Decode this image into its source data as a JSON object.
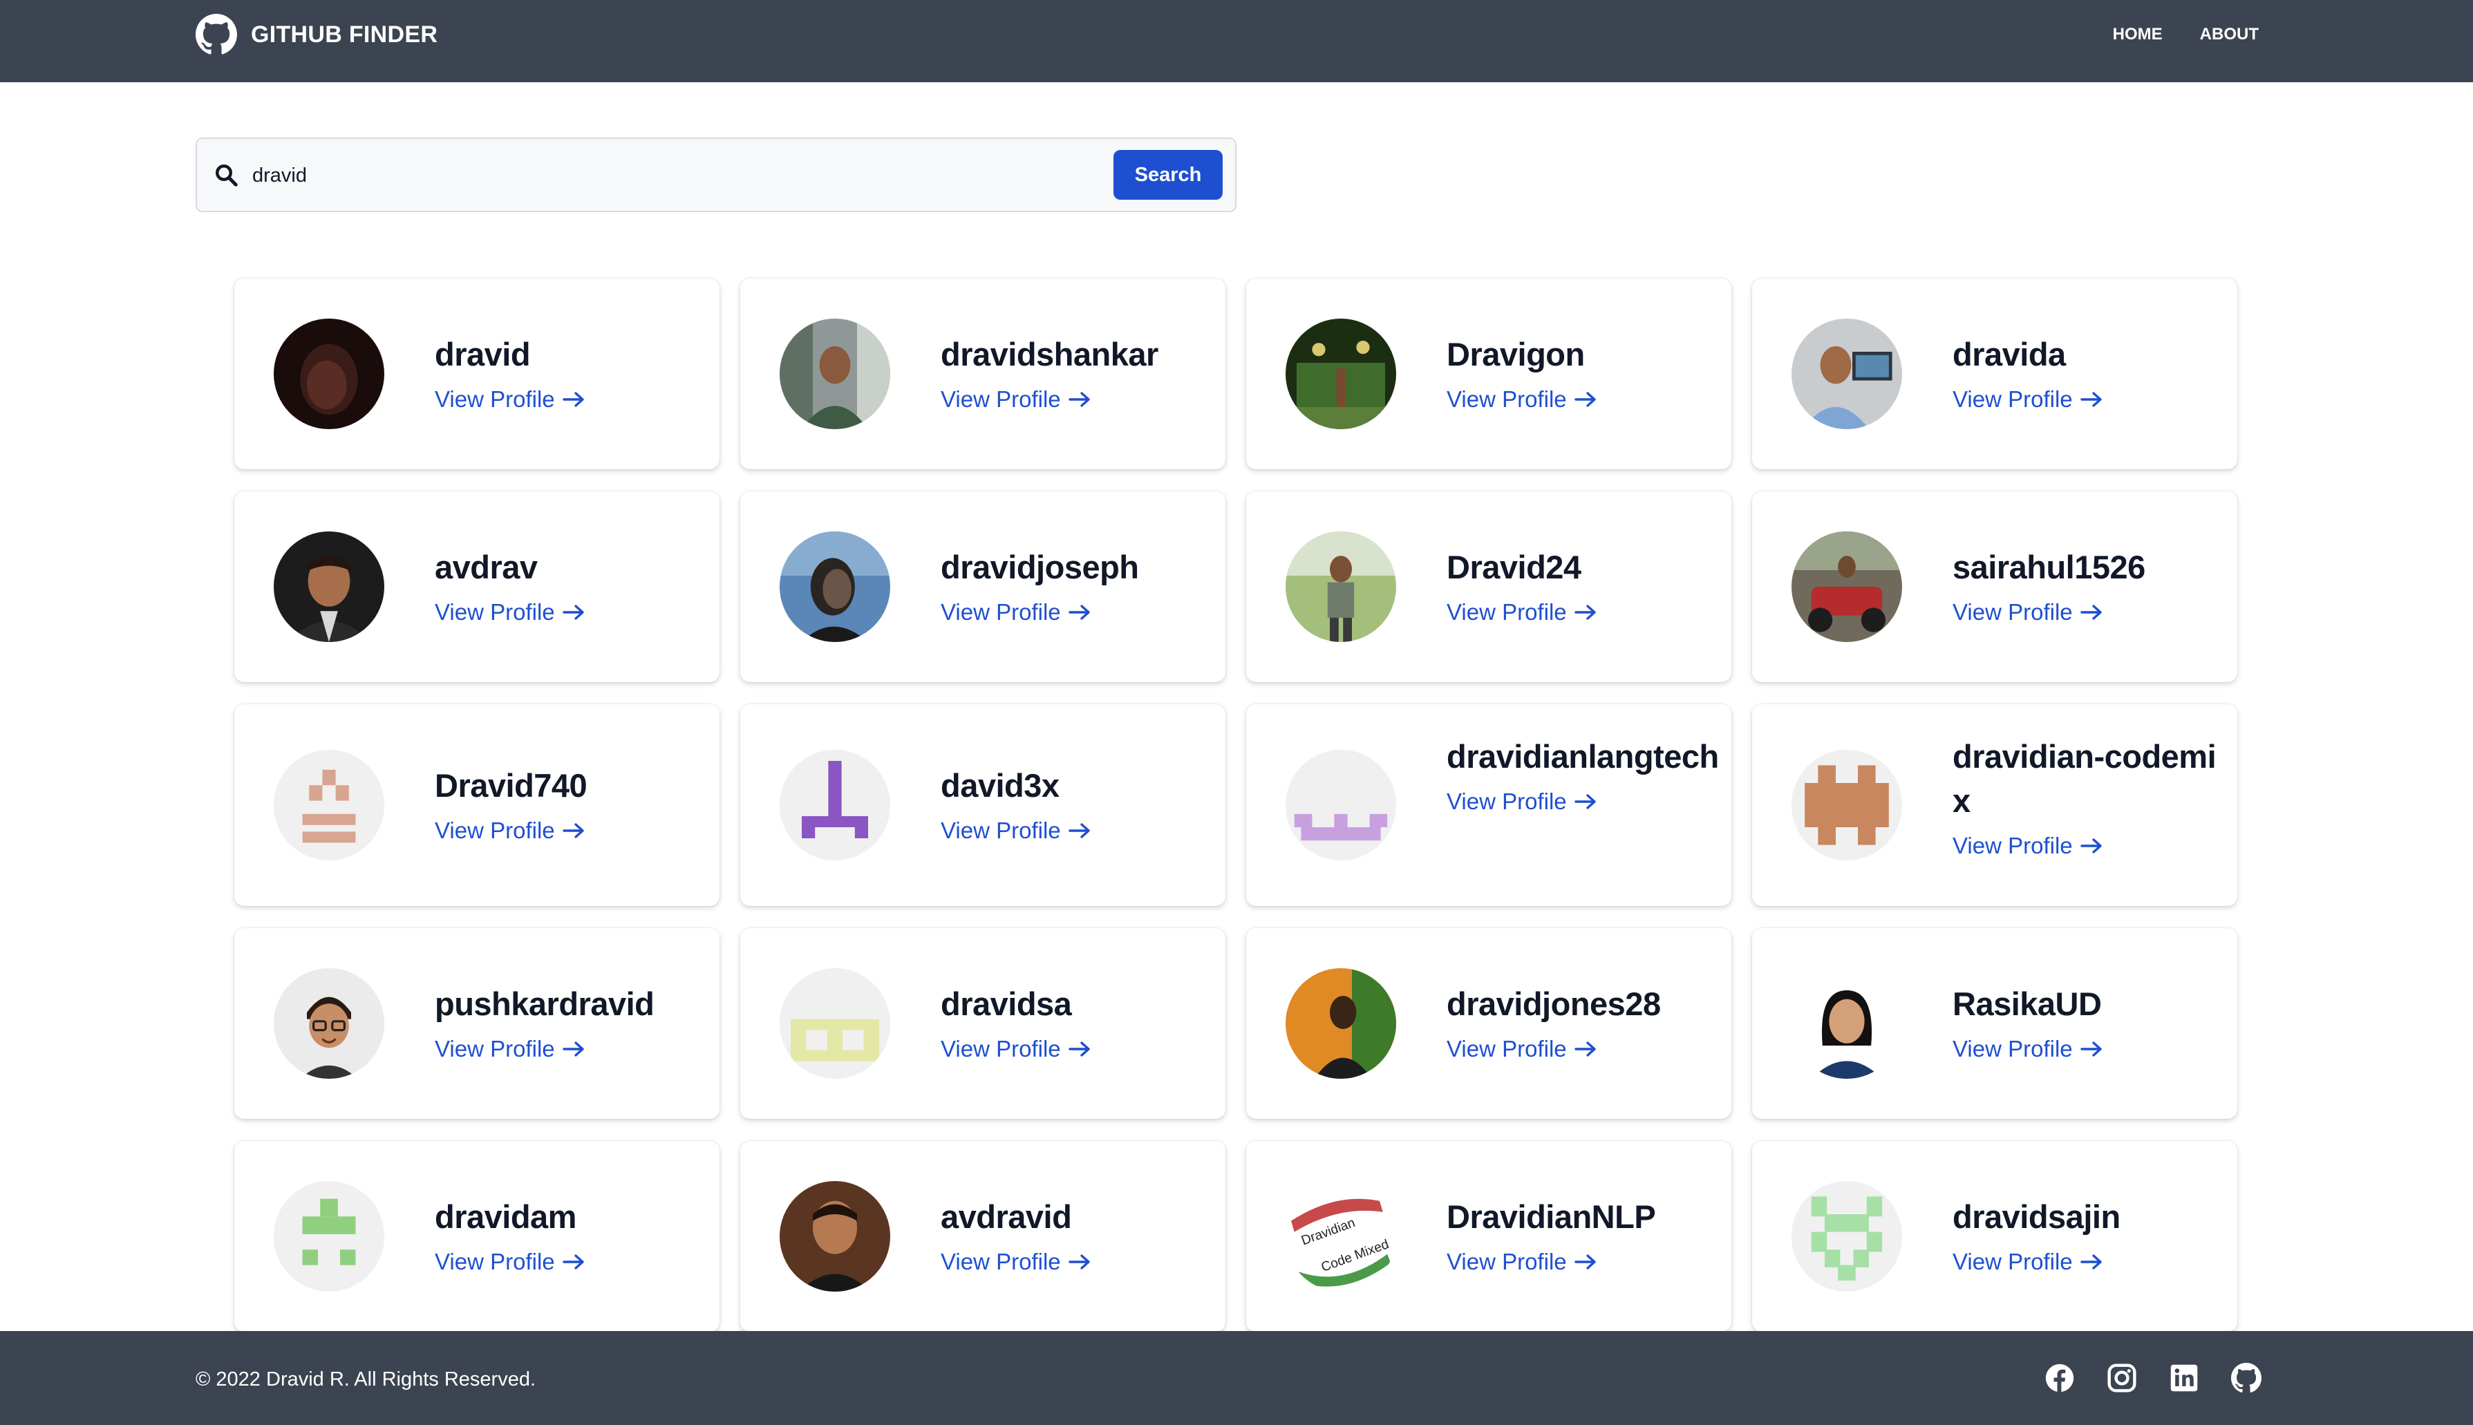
{
  "navbar": {
    "brand": "GITHUB FINDER",
    "brand_icon": "github-icon",
    "links": [
      "HOME",
      "ABOUT"
    ]
  },
  "search": {
    "value": "dravid",
    "button_label": "Search",
    "icon": "search-icon"
  },
  "users": [
    {
      "name": "dravid",
      "link_label": "View Profile",
      "avatar": "photo"
    },
    {
      "name": "dravidshankar",
      "link_label": "View Profile",
      "avatar": "photo"
    },
    {
      "name": "Dravigon",
      "link_label": "View Profile",
      "avatar": "photo"
    },
    {
      "name": "dravida",
      "link_label": "View Profile",
      "avatar": "photo"
    },
    {
      "name": "avdrav",
      "link_label": "View Profile",
      "avatar": "photo"
    },
    {
      "name": "dravidjoseph",
      "link_label": "View Profile",
      "avatar": "photo"
    },
    {
      "name": "Dravid24",
      "link_label": "View Profile",
      "avatar": "photo"
    },
    {
      "name": "sairahul1526",
      "link_label": "View Profile",
      "avatar": "photo"
    },
    {
      "name": "Dravid740",
      "link_label": "View Profile",
      "avatar": "identicon"
    },
    {
      "name": "david3x",
      "link_label": "View Profile",
      "avatar": "identicon"
    },
    {
      "name": "dravidianlangtech",
      "link_label": "View Profile",
      "avatar": "identicon"
    },
    {
      "name": "dravidian-codemix",
      "link_label": "View Profile",
      "avatar": "identicon"
    },
    {
      "name": "pushkardravid",
      "link_label": "View Profile",
      "avatar": "cartoon"
    },
    {
      "name": "dravidsa",
      "link_label": "View Profile",
      "avatar": "identicon"
    },
    {
      "name": "dravidjones28",
      "link_label": "View Profile",
      "avatar": "photo"
    },
    {
      "name": "RasikaUD",
      "link_label": "View Profile",
      "avatar": "photo"
    },
    {
      "name": "dravidam",
      "link_label": "View Profile",
      "avatar": "identicon"
    },
    {
      "name": "avdravid",
      "link_label": "View Profile",
      "avatar": "photo"
    },
    {
      "name": "DravidianNLP",
      "link_label": "View Profile",
      "avatar": "logo",
      "avatar_text": [
        "Dravidian",
        "Code Mixed"
      ]
    },
    {
      "name": "dravidsajin",
      "link_label": "View Profile",
      "avatar": "identicon"
    }
  ],
  "footer": {
    "copyright": "© 2022 Dravid R. All Rights Reserved.",
    "social_icons": [
      "facebook-icon",
      "instagram-icon",
      "linkedin-icon",
      "github-icon"
    ]
  },
  "colors": {
    "nav_bg": "#3d4451",
    "accent": "#1f4fd1",
    "link": "#1f4fd1"
  }
}
